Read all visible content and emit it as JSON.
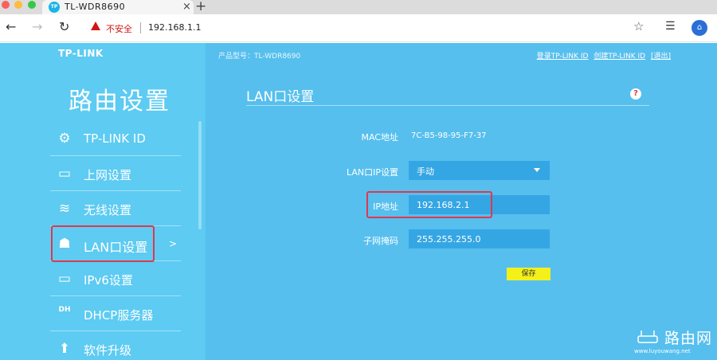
{
  "browser": {
    "tab_title": "TL-WDR8690",
    "favicon_text": "TP",
    "close_glyph": "×",
    "new_tab_glyph": "+",
    "back_glyph": "←",
    "forward_glyph": "→",
    "reload_glyph": "↻",
    "security_label": "不安全",
    "url": "192.168.1.1",
    "star_glyph": "☆",
    "reading_list_glyph": "☰"
  },
  "header": {
    "logo": "TP-LINK",
    "model": "产品型号：TL-WDR8690",
    "links": [
      "登录TP-LINK ID",
      "创建TP-LINK ID",
      "[退出]"
    ]
  },
  "sidebar": {
    "title": "路由设置",
    "items": [
      {
        "label": "TP-LINK ID",
        "icon": "gear-icon",
        "glyph": "⚙"
      },
      {
        "label": "上网设置",
        "icon": "laptop-icon",
        "glyph": "▭"
      },
      {
        "label": "无线设置",
        "icon": "wifi-icon",
        "glyph": "≋"
      },
      {
        "label": "LAN口设置",
        "icon": "lan-port-icon",
        "glyph": "☗"
      },
      {
        "label": "IPv6设置",
        "icon": "laptop-icon",
        "glyph": "▭"
      },
      {
        "label": "DHCP服务器",
        "icon": "dhcp-icon",
        "glyph": "DH"
      },
      {
        "label": "软件升级",
        "icon": "upload-arrow-icon",
        "glyph": "⬆"
      }
    ],
    "active_chevron": ">"
  },
  "main": {
    "section_title": "LAN口设置",
    "help_glyph": "?",
    "mac": {
      "label": "MAC地址",
      "value": "7C-B5-98-95-F7-37"
    },
    "lan_ip_setting": {
      "label": "LAN口IP设置",
      "value": "手动"
    },
    "ip": {
      "label": "IP地址",
      "value": "192.168.2.1"
    },
    "subnet": {
      "label": "子网掩码",
      "value": "255.255.255.0"
    },
    "save_label": "保存"
  },
  "watermark": {
    "main": "路由网",
    "sub": "www.luyouwang.net"
  },
  "colors": {
    "sidebar_bg": "#5dcbf2",
    "main_bg": "#56bfee",
    "input_bg": "#35a6e4",
    "save_button": "#f3f01a",
    "highlight_red": "#e0384c",
    "warning_red": "#d01716"
  }
}
